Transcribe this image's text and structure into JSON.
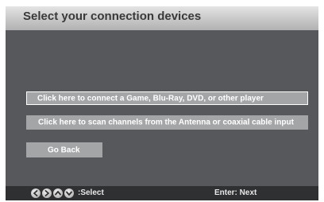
{
  "header": {
    "title": "Select your connection devices"
  },
  "options": [
    {
      "label": "Click here to connect a Game, Blu-Ray, DVD, or other player",
      "selected": true
    },
    {
      "label": "Click here to scan channels from the Antenna or coaxial cable input",
      "selected": false
    },
    {
      "label": "Go Back",
      "selected": false
    }
  ],
  "footer": {
    "nav_icons": [
      "left-arrow-icon",
      "right-arrow-icon",
      "up-arrow-icon",
      "down-arrow-icon"
    ],
    "select_label": ":Select",
    "enter_label": "Enter: Next"
  },
  "colors": {
    "background": "#57585b",
    "header": "#c7c7c7",
    "option": "#a4a5a7",
    "selected_border": "#ffffff",
    "footer": "#2f3032"
  }
}
